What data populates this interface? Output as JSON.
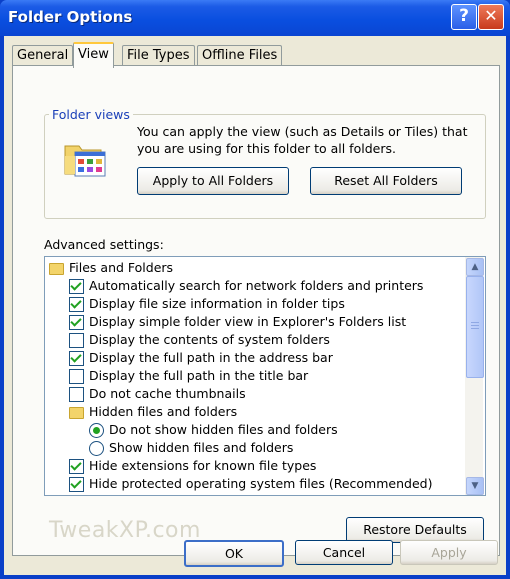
{
  "window": {
    "title": "Folder Options",
    "help_glyph": "?",
    "close_glyph": "✕"
  },
  "tabs": [
    {
      "label": "General",
      "active": false
    },
    {
      "label": "View",
      "active": true
    },
    {
      "label": "File Types",
      "active": false
    },
    {
      "label": "Offline Files",
      "active": false
    }
  ],
  "folder_views": {
    "legend": "Folder views",
    "description": "You can apply the view (such as Details or Tiles) that you are using for this folder to all folders.",
    "apply_button": "Apply to All Folders",
    "reset_button": "Reset All Folders"
  },
  "advanced": {
    "label": "Advanced settings:",
    "items": [
      {
        "type": "folder",
        "label": "Files and Folders",
        "indent": 0
      },
      {
        "type": "checkbox",
        "label": "Automatically search for network folders and printers",
        "checked": true,
        "indent": 1
      },
      {
        "type": "checkbox",
        "label": "Display file size information in folder tips",
        "checked": true,
        "indent": 1
      },
      {
        "type": "checkbox",
        "label": "Display simple folder view in Explorer's Folders list",
        "checked": true,
        "indent": 1
      },
      {
        "type": "checkbox",
        "label": "Display the contents of system folders",
        "checked": false,
        "indent": 1
      },
      {
        "type": "checkbox",
        "label": "Display the full path in the address bar",
        "checked": true,
        "indent": 1
      },
      {
        "type": "checkbox",
        "label": "Display the full path in the title bar",
        "checked": false,
        "indent": 1
      },
      {
        "type": "checkbox",
        "label": "Do not cache thumbnails",
        "checked": false,
        "indent": 1
      },
      {
        "type": "folder",
        "label": "Hidden files and folders",
        "indent": 1
      },
      {
        "type": "radio",
        "label": "Do not show hidden files and folders",
        "checked": true,
        "indent": 2
      },
      {
        "type": "radio",
        "label": "Show hidden files and folders",
        "checked": false,
        "indent": 2
      },
      {
        "type": "checkbox",
        "label": "Hide extensions for known file types",
        "checked": true,
        "indent": 1
      },
      {
        "type": "checkbox",
        "label": "Hide protected operating system files (Recommended)",
        "checked": true,
        "indent": 1
      }
    ]
  },
  "watermark": "TweakXP.com",
  "restore_button": "Restore Defaults",
  "footer": {
    "ok": "OK",
    "cancel": "Cancel",
    "apply": "Apply"
  },
  "colors": {
    "title_bar": "#0a4fe0",
    "dialog_face": "#ece9d8",
    "tab_highlight": "#ffc83c",
    "check_mark": "#21a121",
    "group_legend": "#1a3fb8"
  }
}
